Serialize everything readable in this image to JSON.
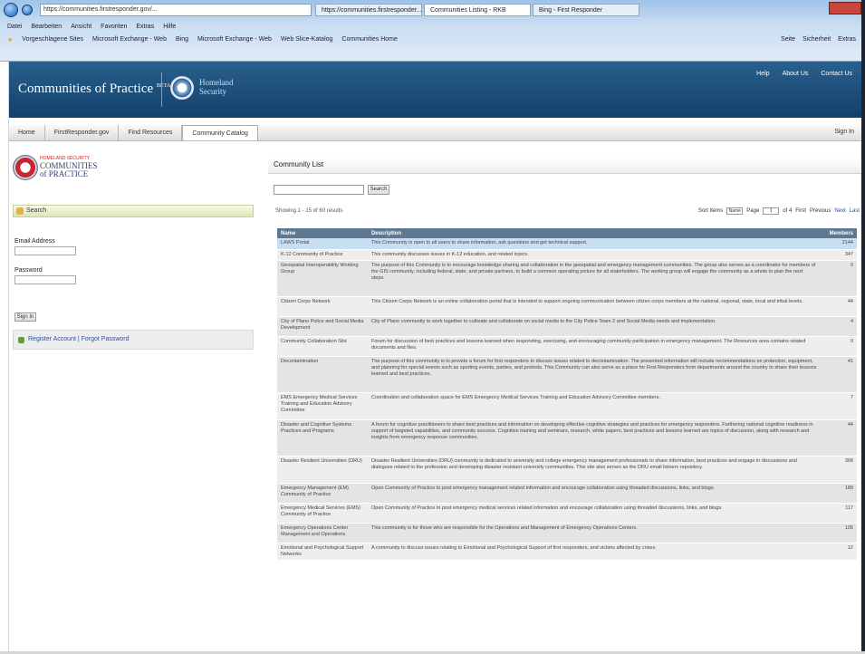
{
  "browser": {
    "address": "https://communities.firstresponder.gov/...",
    "tabs": [
      "https://communities.firstresponder...",
      "Communities Listing - RKB",
      "Bing - First Responder"
    ],
    "menu": [
      "Datei",
      "Bearbeiten",
      "Ansicht",
      "Favoriten",
      "Extras",
      "Hilfe"
    ],
    "favorites": [
      "Vorgeschlagene Sites",
      "Microsoft Exchange - Web",
      "Bing",
      "Microsoft Exchange - Web",
      "Web Slice-Katalog",
      "Communities Home"
    ],
    "tools": [
      "Seite",
      "Sicherheit",
      "Extras"
    ]
  },
  "header": {
    "title": "Communities of Practice",
    "title_sup": "BETA",
    "org": [
      "Homeland",
      "Security"
    ],
    "links": [
      "Help",
      "About Us",
      "Contact Us"
    ]
  },
  "nav": {
    "tabs": [
      "Home",
      "FirstResponder.gov",
      "Find Resources",
      "Community Catalog"
    ],
    "active": 3,
    "signout": "Sign In"
  },
  "logo": {
    "small": "HOMELAND SECURITY",
    "line1": "COMMUNITIES",
    "line2": "of PRACTICE"
  },
  "sidebar": {
    "search_label": "Search",
    "email_label": "Email Address",
    "password_label": "Password",
    "signin_label": "Sign In",
    "links": "Register Account | Forgot Password"
  },
  "main": {
    "title": "Community List",
    "search_button": "Search",
    "showing": "Showing 1 - 15 of 60 results",
    "pager": {
      "sort_label": "Sort Items",
      "sort_value": "Name",
      "page_label": "Page",
      "page_value": "1",
      "of_text": "of 4",
      "first": "First",
      "prev": "Previous",
      "next": "Next",
      "last": "Last"
    },
    "columns": [
      "Name",
      "Description",
      "Members"
    ],
    "rows": [
      {
        "name": "LAWS Portal",
        "desc": "This Community is open to all users to share information, ask questions and get technical support.",
        "members": "2144"
      },
      {
        "name": "K-12 Community of Practice",
        "desc": "This community discusses issues in K-12 education, and related topics.",
        "members": "347"
      },
      {
        "name": "Geospatial Interoperability Working Group",
        "desc": "The purpose of this Community is to encourage knowledge sharing and collaboration in the geospatial and emergency management communities. The group also serves as a coordinator for members of the GIS community, including federal, state, and private partners, to build a common operating picture for all stakeholders. The working group will engage the community as a whole to plan the next steps.",
        "members": "0"
      },
      {
        "name": "Citizen Corps Network",
        "desc": "This Citizen Corps Network is an online collaboration portal that is intended to support ongoing communication between citizen corps members at the national, regional, state, local and tribal levels.",
        "members": "44"
      },
      {
        "name": "City of Plano Police and Social Media Development",
        "desc": "City of Plano community to work together to cultivate and collaborate on social media to the City Police Team 2 and Social Media needs and implementation.",
        "members": "4"
      },
      {
        "name": "Community Collaboration Site",
        "desc": "Forum for discussion of best practices and lessons learned when responding, exercising, and encouraging community participation in emergency management. The Resources area contains related documents and files.",
        "members": "0"
      },
      {
        "name": "Decontamination",
        "desc": "The purpose of this community is to provide a forum for first responders to discuss issues related to decontamination. The presented information will include recommendations on protection, equipment, and planning for special events such as sporting events, parties, and protests. This Community can also serve as a place for First Responders from departments around the country to share their lessons learned and best practices.",
        "members": "41"
      },
      {
        "name": "EMS Emergency Medical Services Training and Education Advisory Committee",
        "desc": "Coordination and collaboration space for EMS Emergency Medical Services Training and Education Advisory Committee members.",
        "members": "7"
      },
      {
        "name": "Disaster and Cognitive Systems Practices and Programs",
        "desc": "A forum for cognitive practitioners to share best practices and information on developing effective cognitive strategies and practices for emergency responders. Furthering national cognitive readiness in support of targeted capabilities, and community success. Cognitive training and seminars, research, white papers, best practices and lessons learned are topics of discussion, along with research and insights from emergency response communities.",
        "members": "44"
      },
      {
        "name": "Disaster Resilient Universities (DRU)",
        "desc": "Disaster Resilient Universities (DRU) community is dedicated to university and college emergency management professionals to share information, best practices and engage in discussions and dialogues related to the profession and developing disaster resistant university communities. This site also serves as the DRU email listserv repository.",
        "members": "368"
      },
      {
        "name": "Emergency Management (EM) Community of Practice",
        "desc": "Open Community of Practice to post emergency management related information and encourage collaboration using threaded discussions, links, and blogs.",
        "members": "189"
      },
      {
        "name": "Emergency Medical Services (EMS) Community of Practice",
        "desc": "Open Community of Practice to post emergency medical services related information and encourage collaboration using threaded discussions, links, and blogs.",
        "members": "117"
      },
      {
        "name": "Emergency Operations Center Management and Operations",
        "desc": "This community is for those who are responsible for the Operations and Management of Emergency Operations Centers.",
        "members": "105"
      },
      {
        "name": "Emotional and Psychological Support Networks",
        "desc": "A community to discuss issues relating to Emotional and Psychological Support of first responders, and victims affected by crises.",
        "members": "12"
      }
    ]
  }
}
